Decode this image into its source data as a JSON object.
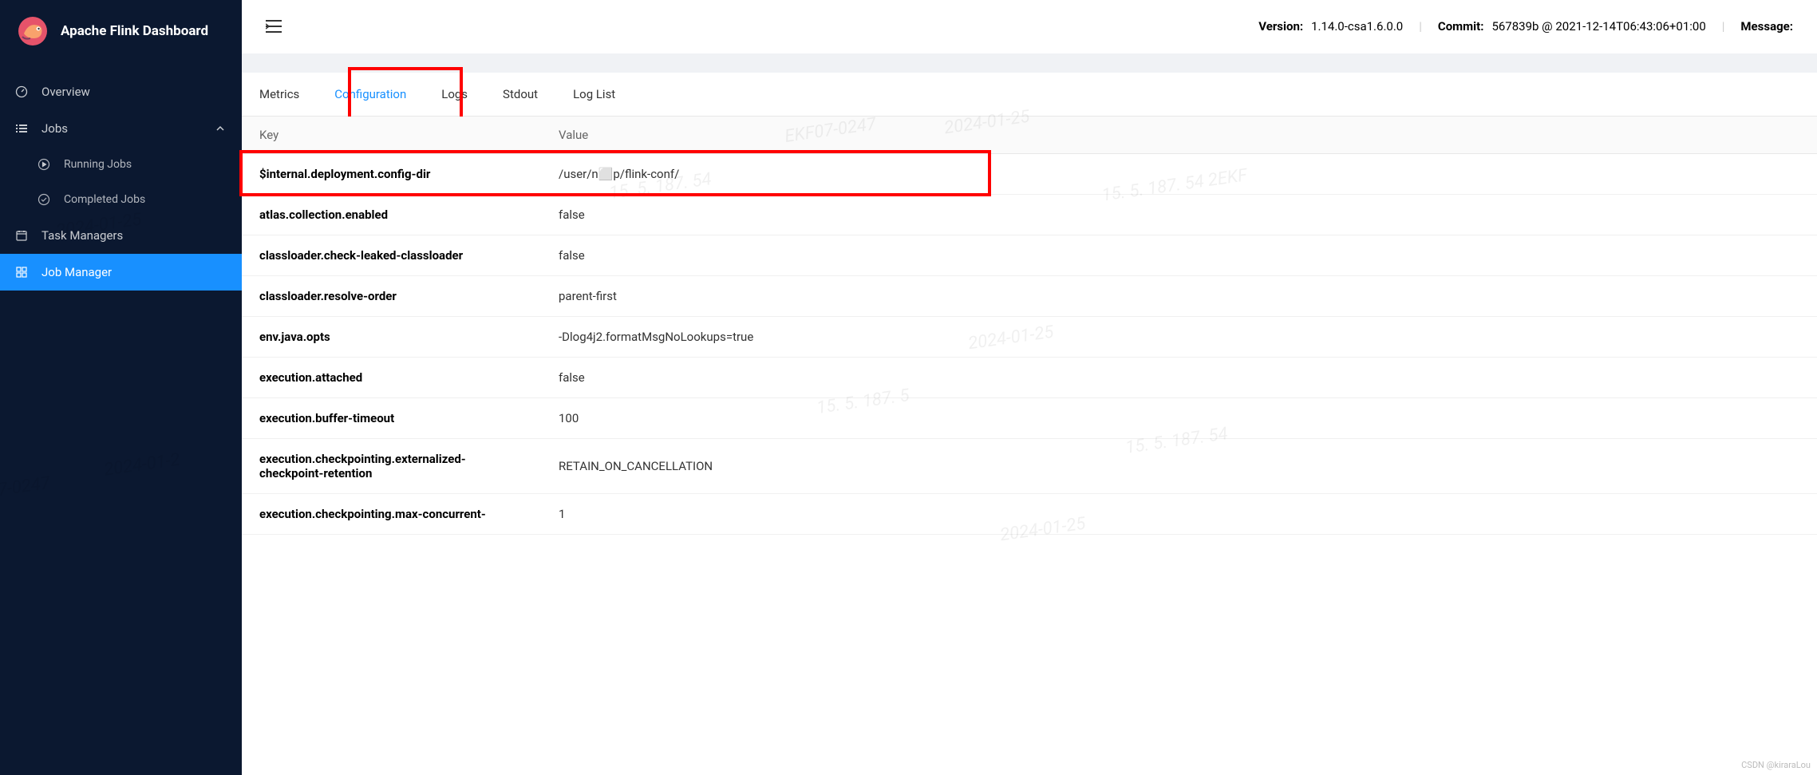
{
  "brand": {
    "title": "Apache Flink Dashboard"
  },
  "sidebar": {
    "overview": "Overview",
    "jobs": "Jobs",
    "running_jobs": "Running Jobs",
    "completed_jobs": "Completed Jobs",
    "task_managers": "Task Managers",
    "job_manager": "Job Manager"
  },
  "topbar": {
    "version_label": "Version:",
    "version_value": "1.14.0-csa1.6.0.0",
    "commit_label": "Commit:",
    "commit_value": "567839b @ 2021-12-14T06:43:06+01:00",
    "message_label": "Message:"
  },
  "tabs": {
    "metrics": "Metrics",
    "configuration": "Configuration",
    "logs": "Logs",
    "stdout": "Stdout",
    "log_list": "Log List"
  },
  "table": {
    "header_key": "Key",
    "header_value": "Value",
    "rows": [
      {
        "key": "$internal.deployment.config-dir",
        "value": "/user/n⬜p/flink-conf/"
      },
      {
        "key": "atlas.collection.enabled",
        "value": "false"
      },
      {
        "key": "classloader.check-leaked-classloader",
        "value": "false"
      },
      {
        "key": "classloader.resolve-order",
        "value": "parent-first"
      },
      {
        "key": "env.java.opts",
        "value": "-Dlog4j2.formatMsgNoLookups=true"
      },
      {
        "key": "execution.attached",
        "value": "false"
      },
      {
        "key": "execution.buffer-timeout",
        "value": "100"
      },
      {
        "key": "execution.checkpointing.externalized-checkpoint-retention",
        "value": "RETAIN_ON_CANCELLATION"
      },
      {
        "key": "execution.checkpointing.max-concurrent-",
        "value": "1"
      }
    ]
  },
  "watermarks": {
    "csdn": "CSDN @kiraraLou"
  }
}
